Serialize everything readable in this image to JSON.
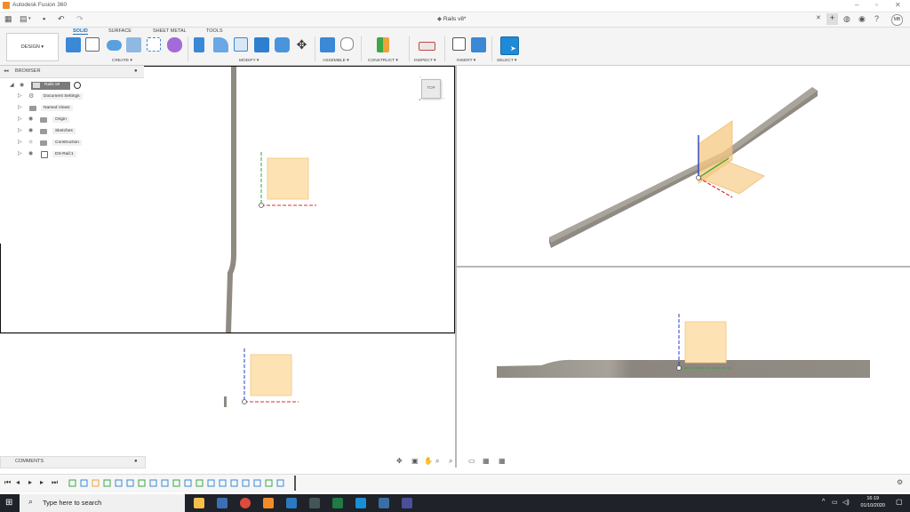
{
  "app": {
    "title": "Autodesk Fusion 360"
  },
  "document": {
    "tab_title": "Rails v8*"
  },
  "user": {
    "initials": "MB"
  },
  "ribbon": {
    "workspace_button": "DESIGN ▾",
    "tabs": [
      "SOLID",
      "SURFACE",
      "SHEET METAL",
      "TOOLS"
    ],
    "groups": [
      "CREATE ▾",
      "MODIFY ▾",
      "ASSEMBLE ▾",
      "CONSTRUCT ▾",
      "INSPECT ▾",
      "INSERT ▾",
      "SELECT ▾"
    ]
  },
  "browser": {
    "header": "BROWSER",
    "root": "Rails v8",
    "items": [
      "Document Settings",
      "Named Views",
      "Origin",
      "Sketches",
      "Construction",
      "DS-Rail:1"
    ]
  },
  "viewcube": {
    "face": "TOP"
  },
  "comments": {
    "label": "COMMENTS"
  },
  "taskbar": {
    "search_placeholder": "Type here to search",
    "time": "16:19",
    "date": "01/10/2020"
  },
  "colors": {
    "accent": "#1f6fb8",
    "plane_fill": "#fde3b4",
    "rail": "#8f8a82",
    "x_axis": "#d62e2e",
    "y_axis": "#2fa53b",
    "z_axis": "#2a3fbf"
  }
}
